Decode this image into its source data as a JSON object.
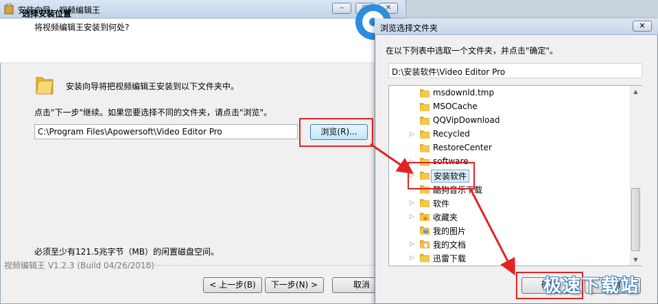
{
  "installer": {
    "title": "安装向导 - 视频编辑王",
    "header_title": "选择安装位置",
    "header_subtitle": "将视频编辑王安装到何处?",
    "intro": "安装向导将把视频编辑王安装到以下文件夹中。",
    "instruction": "点击\"下一步\"继续。如果您要选择不同的文件夹，请点击\"浏览\"。",
    "path_value": "C:\\Program Files\\Apowersoft\\Video Editor Pro",
    "browse_label": "浏览(R)...",
    "space_note": "必须至少有121.5兆字节（MB）的闲置磁盘空间。",
    "version": "视频编辑王 V1.2.3  (Build 04/26/2018)",
    "back_label": "< 上一步(B)",
    "next_label": "下一步(N) >",
    "cancel_label": "取消",
    "window_controls": {
      "minimize": "‒",
      "maximize": "□",
      "close": "✕"
    }
  },
  "browse_dialog": {
    "title": "浏览选择文件夹",
    "close": "✕",
    "instruction": "在以下列表中选取一个文件夹，并点击\"确定\"。",
    "path_value": "D:\\安装软件\\Video Editor Pro",
    "tree_items": [
      {
        "label": "msdownld.tmp",
        "expandable": false,
        "selected": false,
        "icon": "folder-icon"
      },
      {
        "label": "MSOCache",
        "expandable": false,
        "selected": false,
        "icon": "folder-icon"
      },
      {
        "label": "QQVipDownload",
        "expandable": false,
        "selected": false,
        "icon": "folder-icon"
      },
      {
        "label": "Recycled",
        "expandable": true,
        "selected": false,
        "icon": "folder-icon"
      },
      {
        "label": "RestoreCenter",
        "expandable": false,
        "selected": false,
        "icon": "folder-icon"
      },
      {
        "label": "software",
        "expandable": true,
        "selected": false,
        "icon": "folder-icon"
      },
      {
        "label": "安装软件",
        "expandable": true,
        "selected": true,
        "icon": "folder-icon"
      },
      {
        "label": "酷狗音乐下载",
        "expandable": false,
        "selected": false,
        "icon": "folder-icon"
      },
      {
        "label": "软件",
        "expandable": true,
        "selected": false,
        "icon": "folder-icon"
      },
      {
        "label": "收藏夹",
        "expandable": true,
        "selected": false,
        "icon": "favorites-folder-icon"
      },
      {
        "label": "我的图片",
        "expandable": false,
        "selected": false,
        "icon": "pictures-folder-icon"
      },
      {
        "label": "我的文档",
        "expandable": true,
        "selected": false,
        "icon": "documents-folder-icon"
      },
      {
        "label": "迅雷下载",
        "expandable": true,
        "selected": false,
        "icon": "folder-icon"
      }
    ],
    "ok_label": "确定",
    "cancel_label": "取消"
  },
  "watermark": "极速下载站",
  "colors": {
    "highlight": "#e32222",
    "folder": "#f5c84c",
    "selection": "#dcecfc"
  }
}
